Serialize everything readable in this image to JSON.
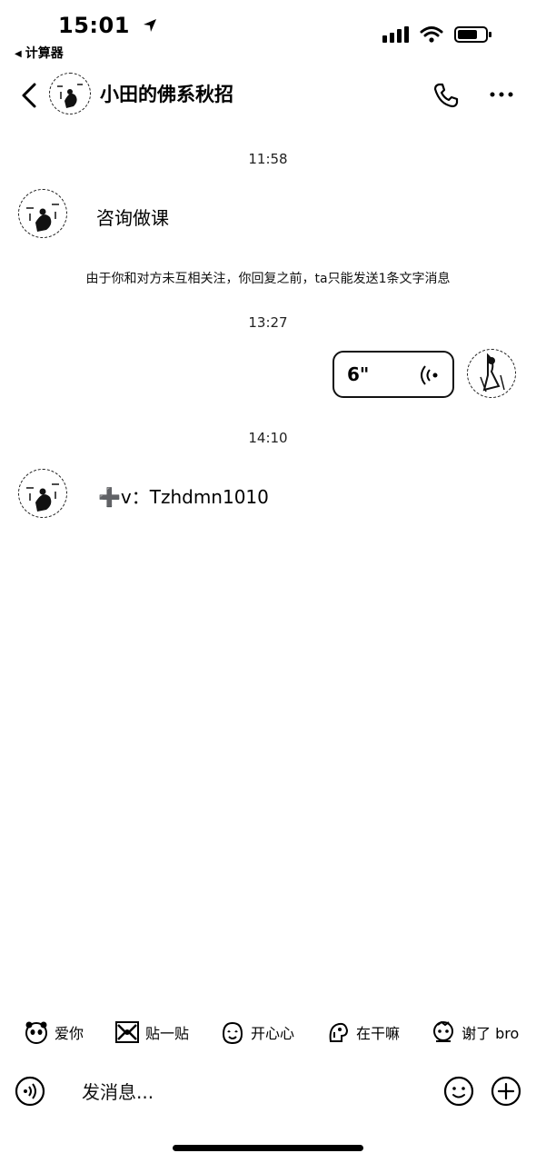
{
  "status_bar": {
    "time": "15:01",
    "back_app": "计算器",
    "battery": "55"
  },
  "header": {
    "title": "小田的佛系秋招"
  },
  "messages": [
    {
      "timestamp": "11:58",
      "text": "咨询做课"
    },
    {
      "notice": "由于你和对方未互相关注，你回复之前，ta只能发送1条文字消息"
    },
    {
      "timestamp": "13:27",
      "voice_seconds": "6\""
    },
    {
      "timestamp": "14:10",
      "text": "➕v：Tzhdmn1010"
    }
  ],
  "quick_stickers": [
    {
      "label": "爱你",
      "icon": "panda-sticker-icon"
    },
    {
      "label": "贴一贴",
      "icon": "hug-sticker-icon"
    },
    {
      "label": "开心心",
      "icon": "happy-sticker-icon"
    },
    {
      "label": "在干嘛",
      "icon": "dino-sticker-icon"
    },
    {
      "label": "谢了 bro",
      "icon": "thanks-sticker-icon"
    }
  ],
  "input": {
    "placeholder": "发消息..."
  }
}
